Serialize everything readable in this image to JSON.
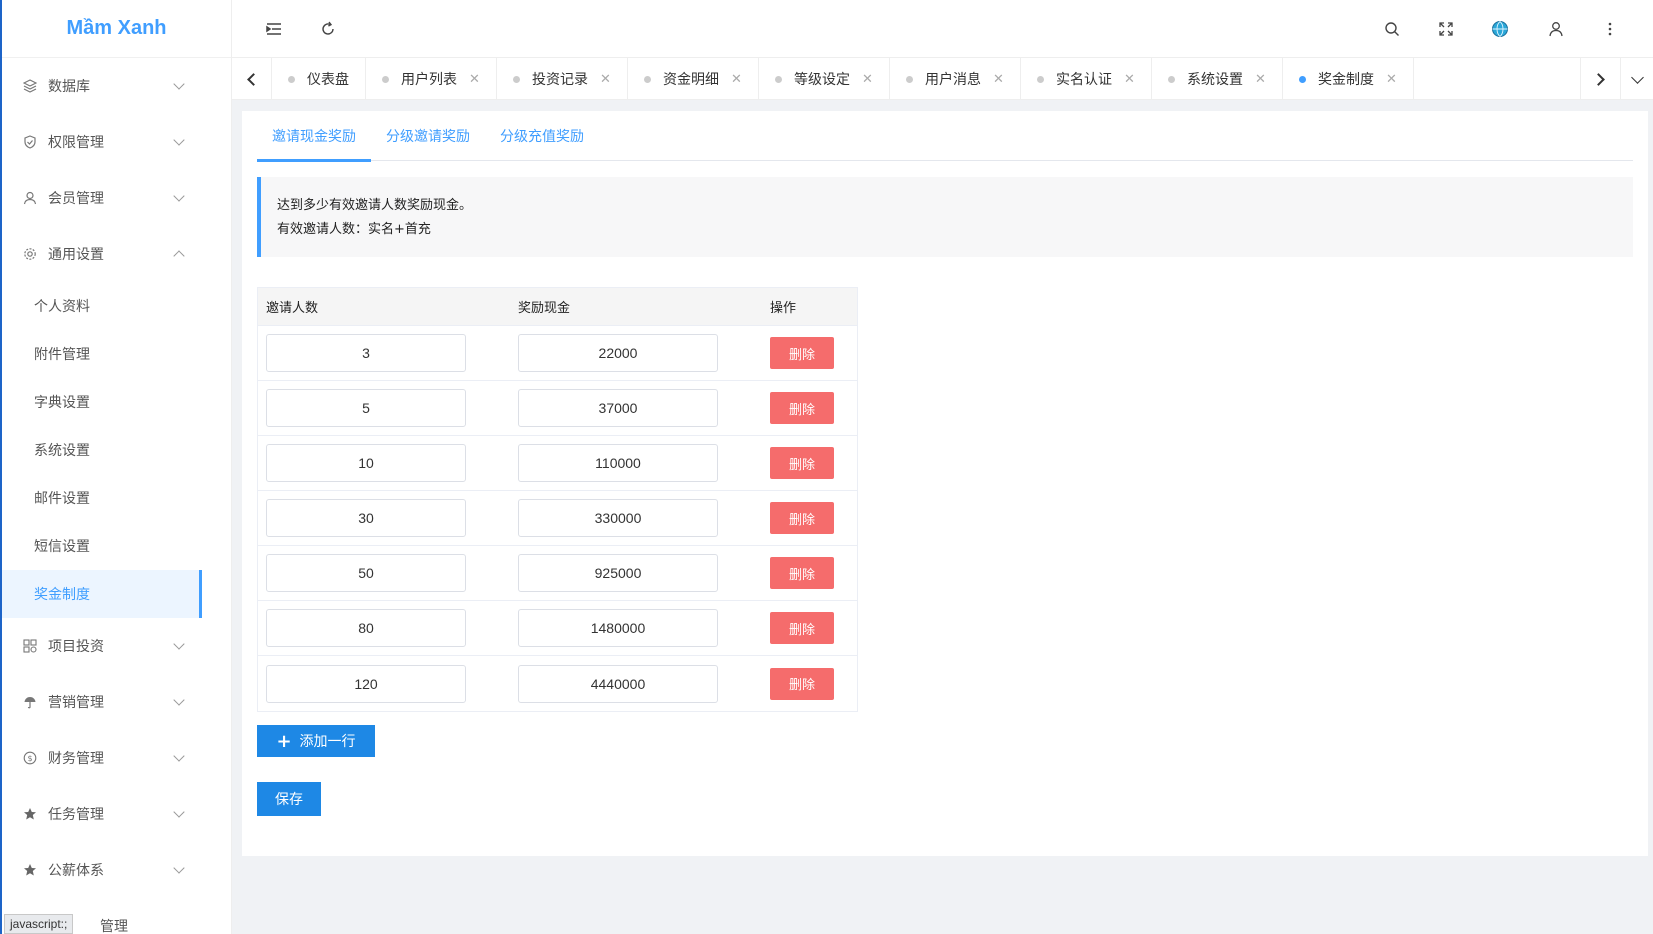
{
  "brand": {
    "logo_text": "Mầm Xanh"
  },
  "sidebar": {
    "groups_top": [
      {
        "label": "数据库",
        "icon": "database-icon"
      },
      {
        "label": "权限管理",
        "icon": "shield-icon"
      },
      {
        "label": "会员管理",
        "icon": "user-icon"
      },
      {
        "label": "通用设置",
        "icon": "gear-icon"
      }
    ],
    "sub_items": [
      {
        "label": "个人资料"
      },
      {
        "label": "附件管理"
      },
      {
        "label": "字典设置"
      },
      {
        "label": "系统设置"
      },
      {
        "label": "邮件设置"
      },
      {
        "label": "短信设置"
      },
      {
        "label": "奖金制度"
      }
    ],
    "groups_bottom": [
      {
        "label": "项目投资",
        "icon": "grid-icon"
      },
      {
        "label": "营销管理",
        "icon": "umbrella-icon"
      },
      {
        "label": "财务管理",
        "icon": "dollar-icon"
      },
      {
        "label": "任务管理",
        "icon": "star-icon"
      },
      {
        "label": "公薪体系",
        "icon": "star-icon"
      },
      {
        "label": "管理",
        "icon": ""
      }
    ],
    "status_link": "javascript:;"
  },
  "tabs": [
    {
      "label": "仪表盘"
    },
    {
      "label": "用户列表"
    },
    {
      "label": "投资记录"
    },
    {
      "label": "资金明细"
    },
    {
      "label": "等级设定"
    },
    {
      "label": "用户消息"
    },
    {
      "label": "实名认证"
    },
    {
      "label": "系统设置"
    },
    {
      "label": "奖金制度"
    }
  ],
  "content_tabs": [
    {
      "label": "邀请现金奖励"
    },
    {
      "label": "分级邀请奖励"
    },
    {
      "label": "分级充值奖励"
    }
  ],
  "notice": {
    "line1": "达到多少有效邀请人数奖励现金。",
    "line2": "有效邀请人数：实名+首充"
  },
  "table": {
    "headers": [
      "邀请人数",
      "奖励现金",
      "操作"
    ],
    "delete_label": "删除",
    "rows": [
      {
        "invites": "3",
        "cash": "22000"
      },
      {
        "invites": "5",
        "cash": "37000"
      },
      {
        "invites": "10",
        "cash": "110000"
      },
      {
        "invites": "30",
        "cash": "330000"
      },
      {
        "invites": "50",
        "cash": "925000"
      },
      {
        "invites": "80",
        "cash": "1480000"
      },
      {
        "invites": "120",
        "cash": "4440000"
      }
    ]
  },
  "actions": {
    "add_row": "添加一行",
    "save": "保存"
  },
  "colors": {
    "accent": "#409eff",
    "danger": "#f56c6c",
    "primary_button": "#1e88e5"
  }
}
